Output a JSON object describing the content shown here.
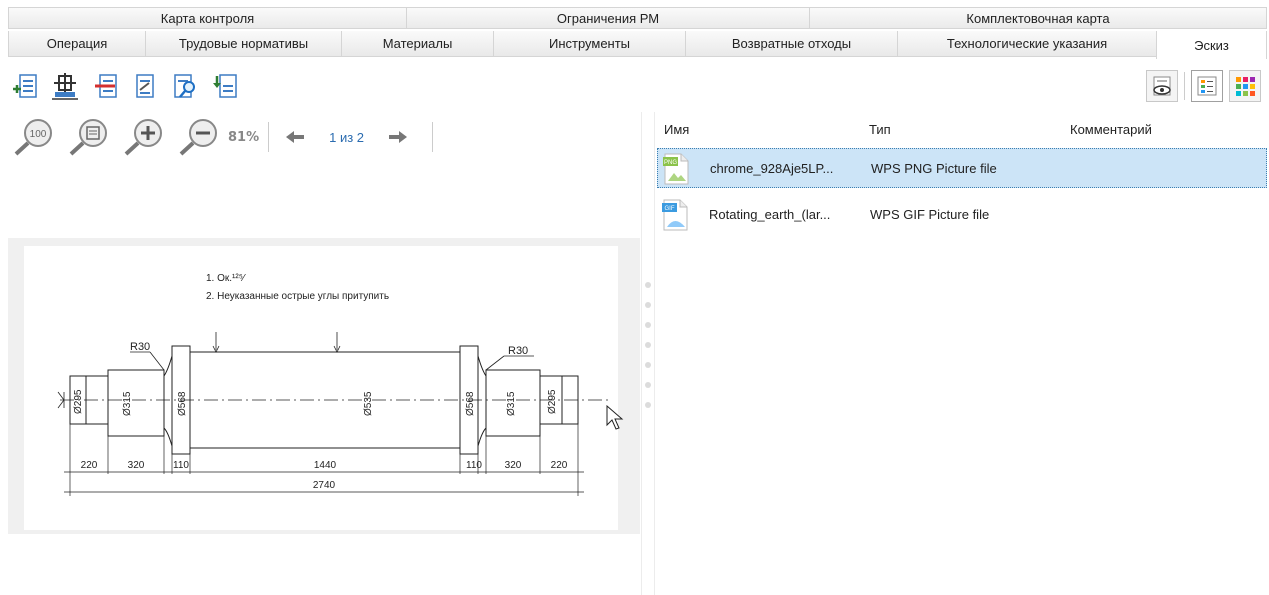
{
  "tabs_top": [
    "Карта контроля",
    "Ограничения РМ",
    "Комплектовочная карта"
  ],
  "tabs_bottom": [
    "Операция",
    "Трудовые нормативы",
    "Материалы",
    "Инструменты",
    "Возвратные отходы",
    "Технологические указания",
    "Эскиз"
  ],
  "active_tab": "Эскиз",
  "toolbar": [
    "add-row-icon",
    "tree-structure-icon",
    "remove-file-icon",
    "edit-file-icon",
    "find-file-icon",
    "import-file-icon"
  ],
  "view_buttons": [
    "preview-icon",
    "list-view-icon",
    "tile-view-icon"
  ],
  "zoom": {
    "label": "81%",
    "buttons": [
      "zoom-100-icon",
      "fit-page-icon",
      "zoom-in-icon",
      "zoom-out-icon"
    ]
  },
  "pager": {
    "text": "1 из 2"
  },
  "files": {
    "columns": [
      "Имя",
      "Тип",
      "Комментарий"
    ],
    "rows": [
      {
        "name": "chrome_928Aje5LP...",
        "type": "WPS PNG Picture file",
        "badge": "PNG",
        "badge_color": "#8bc34a",
        "selected": true
      },
      {
        "name": "Rotating_earth_(lar...",
        "type": "WPS GIF Picture file",
        "badge": "GIF",
        "badge_color": "#3b9be0",
        "selected": false
      }
    ]
  },
  "drawing": {
    "notes": [
      "1. Ок.¹²⁵⁄",
      "2. Неуказанные острые углы притупить"
    ],
    "radius_labels": [
      "R30",
      "R30"
    ],
    "diameters": [
      "Ø295",
      "Ø315",
      "Ø568",
      "Ø535",
      "Ø568",
      "Ø315",
      "Ø295"
    ],
    "lengths": [
      "220",
      "320",
      "110",
      "1440",
      "110",
      "320",
      "220"
    ],
    "total": "2740"
  }
}
